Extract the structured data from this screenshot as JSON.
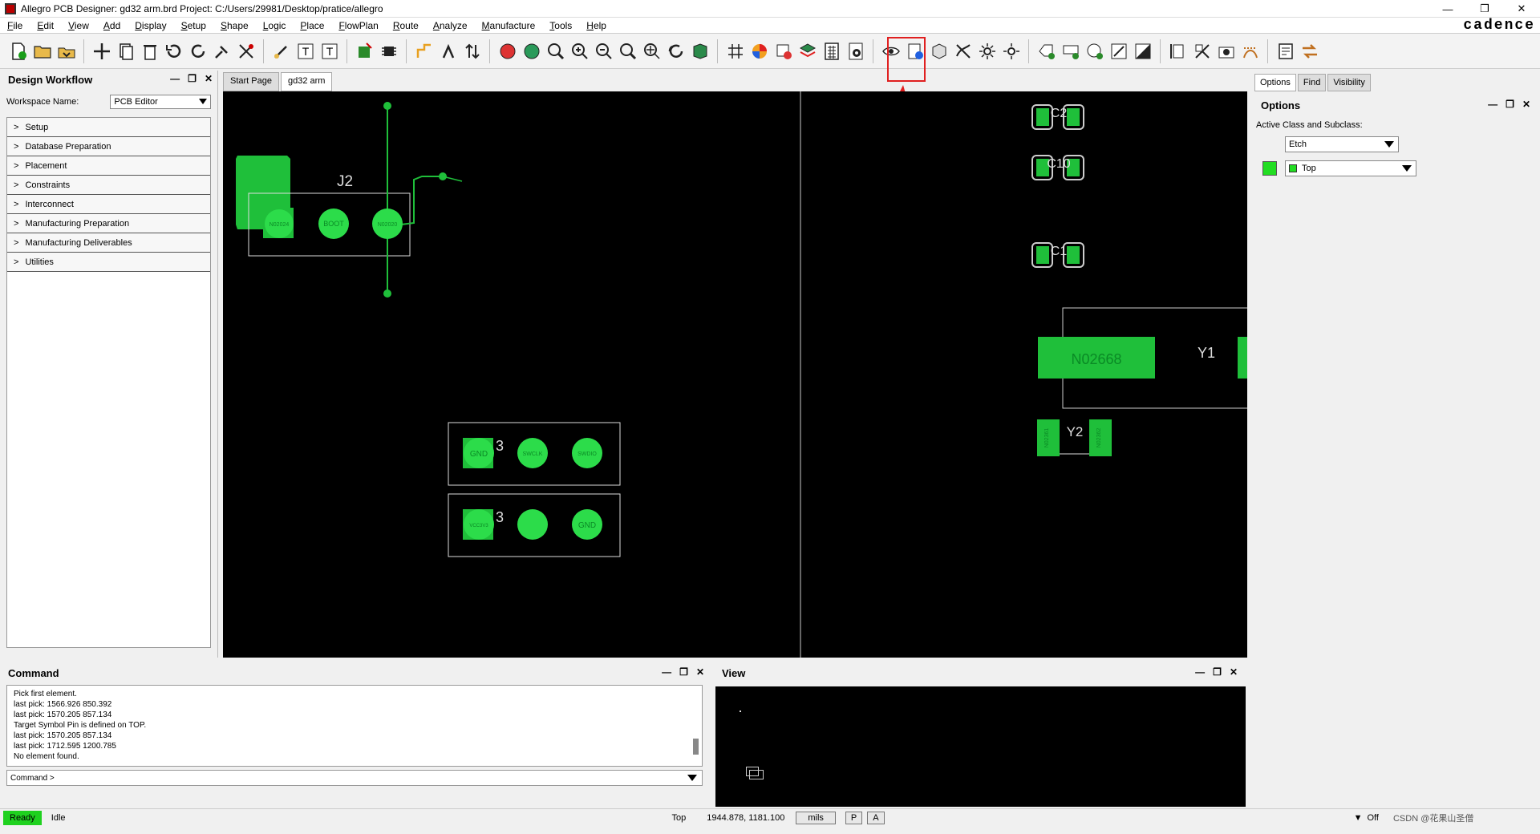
{
  "window": {
    "title": "Allegro PCB Designer: gd32 arm.brd  Project: C:/Users/29981/Desktop/pratice/allegro",
    "brand": "cadence"
  },
  "menu": [
    "File",
    "Edit",
    "View",
    "Add",
    "Display",
    "Setup",
    "Shape",
    "Logic",
    "Place",
    "FlowPlan",
    "Route",
    "Analyze",
    "Manufacture",
    "Tools",
    "Help"
  ],
  "left_panel": {
    "title": "Design Workflow",
    "workspace_label": "Workspace Name:",
    "workspace_value": "PCB Editor",
    "items": [
      "Setup",
      "Database Preparation",
      "Placement",
      "Constraints",
      "Interconnect",
      "Manufacturing Preparation",
      "Manufacturing Deliverables",
      "Utilities"
    ]
  },
  "tabs": [
    "Start Page",
    "gd32 arm"
  ],
  "canvas": {
    "j2_label": "J2",
    "j2_pins": [
      "N02024",
      "BOOT",
      "N02020"
    ],
    "conn_a_pins": [
      "GND",
      "SWCLK",
      "SWDIO"
    ],
    "conn_b_pins": [
      "VCC3V3",
      "",
      "GND"
    ],
    "conn_a_ref": "3",
    "conn_b_ref": "3",
    "c2": "C2",
    "c10": "C10",
    "c1": "C1",
    "y1": "Y1",
    "y1_net": "N02668",
    "y2": "Y2",
    "y2_net_left": "N02361",
    "y2_net_right": "N02362"
  },
  "right_panel": {
    "tabs": [
      "Options",
      "Find",
      "Visibility"
    ],
    "title": "Options",
    "active_label": "Active Class and Subclass:",
    "class_value": "Etch",
    "subclass_value": "Top",
    "subclass_color": "#22dd22"
  },
  "command": {
    "title": "Command",
    "lines": [
      "Pick first element.",
      "last pick:  1566.926 850.392",
      "last pick:  1570.205 857.134",
      "Target Symbol Pin is defined on TOP.",
      "last pick:  1570.205 857.134",
      "last pick:  1712.595 1200.785",
      "No element found."
    ],
    "prompt": "Command >"
  },
  "view_panel": {
    "title": "View"
  },
  "status": {
    "ready": "Ready",
    "idle": "Idle",
    "layer": "Top",
    "coords": "1944.878, 1181.100",
    "units": "mils",
    "p": "P",
    "a": "A",
    "filter": "Off",
    "watermark": "CSDN @花果山圣僧"
  },
  "colors": {
    "pad": "#1fbf3a",
    "pad_dark": "#0a8a25",
    "highlight": "#e02020"
  }
}
